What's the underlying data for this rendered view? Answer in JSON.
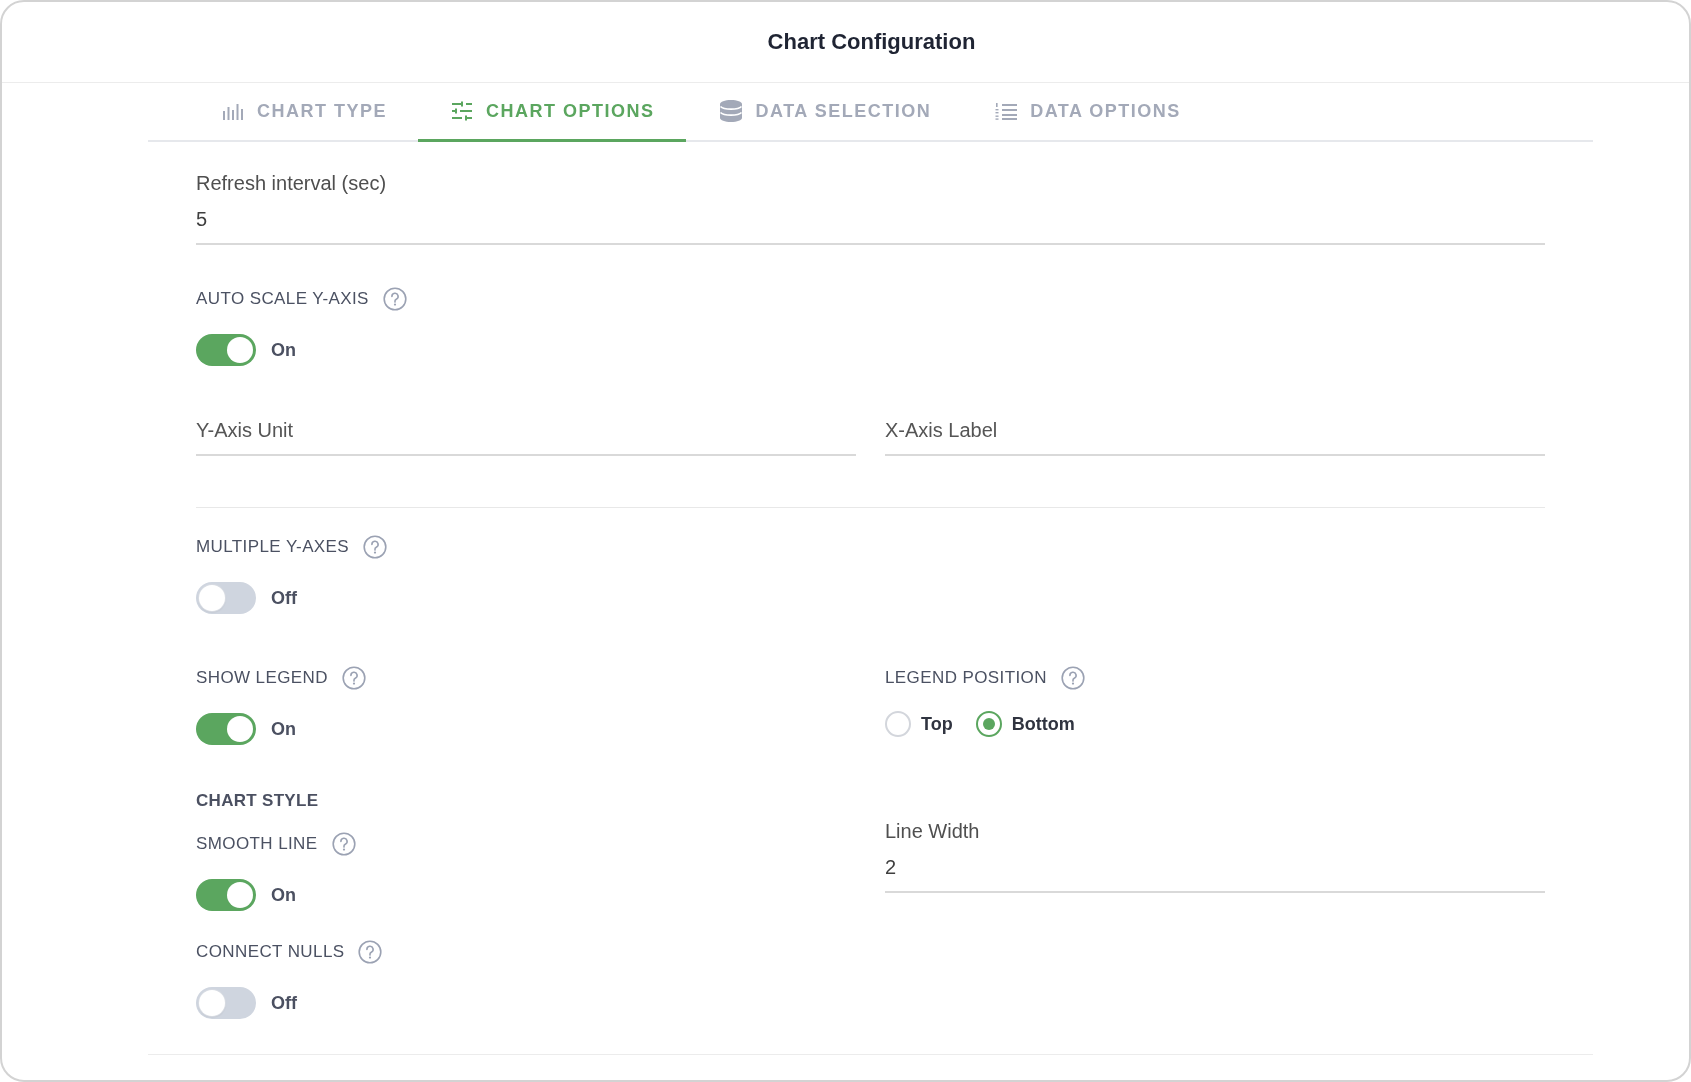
{
  "window": {
    "title": "Chart Configuration"
  },
  "tabs": [
    {
      "label": "CHART TYPE",
      "selected": false
    },
    {
      "label": "CHART OPTIONS",
      "selected": true
    },
    {
      "label": "DATA SELECTION",
      "selected": false
    },
    {
      "label": "DATA OPTIONS",
      "selected": false
    }
  ],
  "refresh_interval": {
    "label": "Refresh interval (sec)",
    "value": "5"
  },
  "auto_scale_y_axis": {
    "label": "AUTO SCALE Y-AXIS",
    "on": true,
    "state_text": "On"
  },
  "axis_fields": [
    {
      "placeholder": "Y-Axis Unit"
    },
    {
      "placeholder": "X-Axis Label"
    }
  ],
  "multiple_y_axes": {
    "label": "MULTIPLE Y-AXES",
    "on": false,
    "state_text": "Off"
  },
  "show_legend": {
    "label": "SHOW LEGEND",
    "on": true,
    "state_text": "On"
  },
  "legend_position": {
    "label": "LEGEND POSITION",
    "options": [
      {
        "label": "Top",
        "selected": false
      },
      {
        "label": "Bottom",
        "selected": true
      }
    ]
  },
  "chart_style": {
    "heading": "CHART STYLE",
    "smooth_line": {
      "label": "SMOOTH LINE",
      "on": true,
      "state_text": "On"
    },
    "connect_nulls": {
      "label": "CONNECT NULLS",
      "on": false,
      "state_text": "Off"
    }
  },
  "line_width": {
    "label": "Line Width",
    "value": "2"
  }
}
